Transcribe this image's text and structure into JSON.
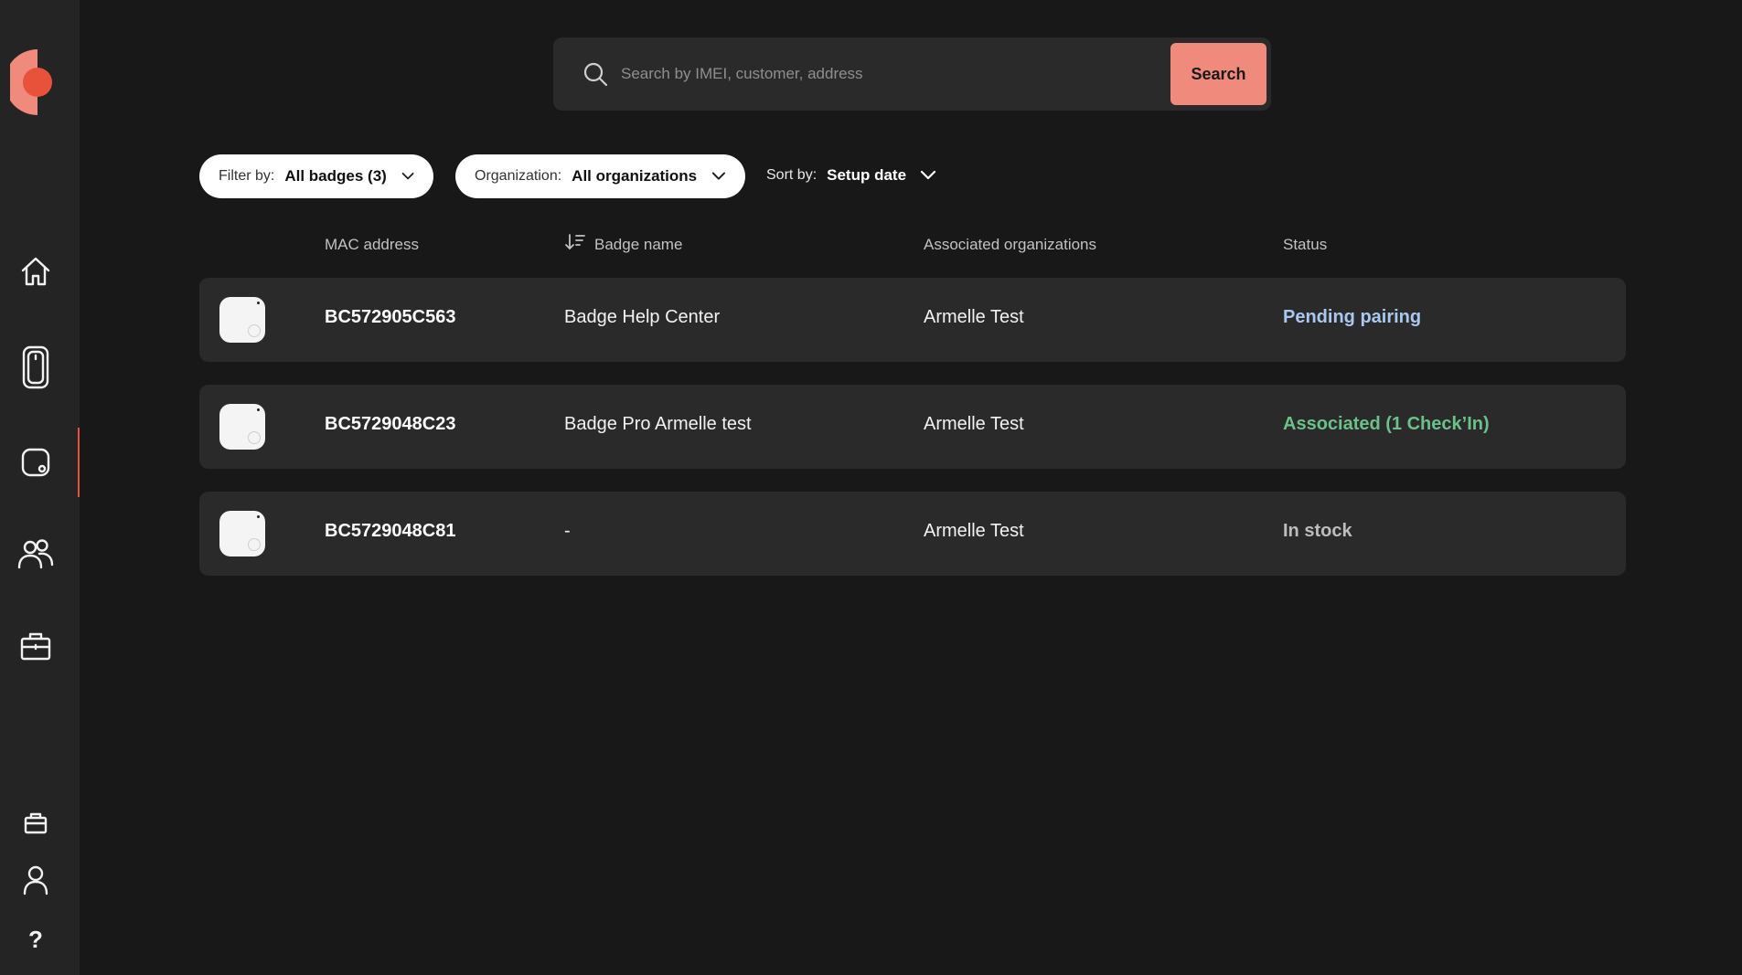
{
  "sidebar": {
    "nav_items": [
      {
        "name": "home-icon"
      },
      {
        "name": "phone-icon"
      },
      {
        "name": "badge-icon"
      },
      {
        "name": "users-icon"
      },
      {
        "name": "briefcase-icon"
      }
    ],
    "bottom_items": [
      {
        "name": "inbox-icon"
      },
      {
        "name": "user-icon"
      },
      {
        "name": "help-icon",
        "glyph": "?"
      }
    ],
    "active_index": 2,
    "brand_colors": {
      "primary": "#e8523a",
      "secondary": "#f08a7c"
    }
  },
  "search": {
    "placeholder": "Search by IMEI, customer, address",
    "value": "",
    "button_label": "Search"
  },
  "filters": {
    "filter_by": {
      "label": "Filter by:",
      "value": "All badges (3)"
    },
    "organization": {
      "label": "Organization:",
      "value": "All organizations"
    },
    "sort_by": {
      "label": "Sort by:",
      "value": "Setup date"
    }
  },
  "table": {
    "columns": {
      "mac": "MAC address",
      "badge_name": "Badge name",
      "orgs": "Associated organizations",
      "status": "Status"
    },
    "rows": [
      {
        "mac": "BC572905C563",
        "badge_name": "Badge Help Center",
        "org": "Armelle Test",
        "status": "Pending pairing",
        "status_color": "#a9c8f0"
      },
      {
        "mac": "BC5729048C23",
        "badge_name": "Badge Pro Armelle test",
        "org": "Armelle Test",
        "status": "Associated (1 Check’In)",
        "status_color": "#6cc08a"
      },
      {
        "mac": "BC5729048C81",
        "badge_name": "-",
        "org": "Armelle Test",
        "status": "In stock",
        "status_color": "#bdbdbd"
      }
    ]
  }
}
